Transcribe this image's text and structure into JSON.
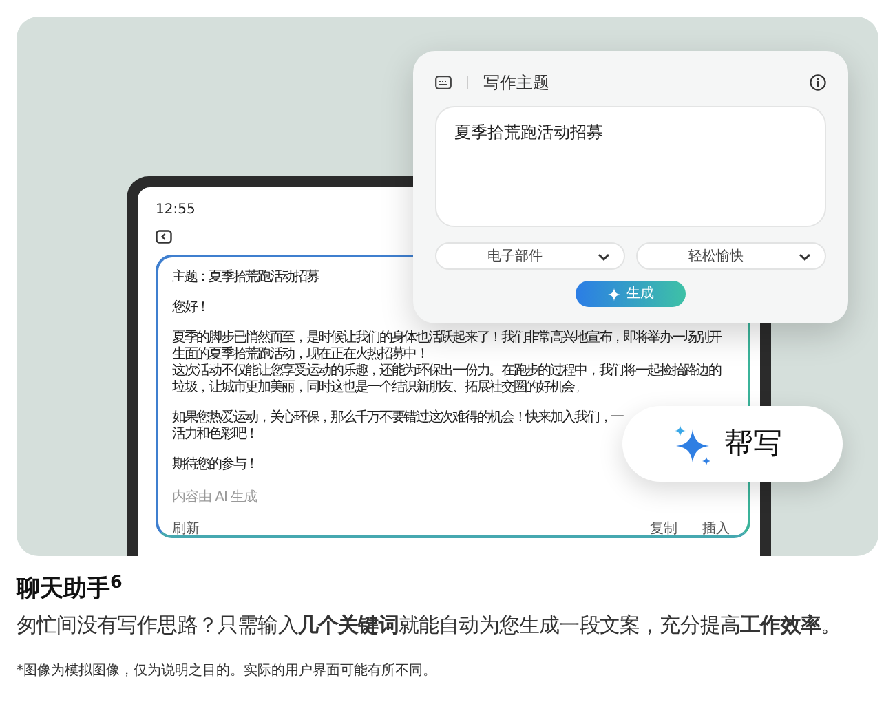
{
  "device": {
    "time": "12:55",
    "email": {
      "subject": "主题：夏季拾荒跑活动招募",
      "paragraphs": [
        {
          "lines": [
            "您好！"
          ]
        },
        {
          "lines": [
            "夏季的脚步已悄然而至，是时候让我们的身体也活跃起来了！我们非常高兴地宣布，即将举办一场别开",
            "生面的夏季拾荒跑活动，现在正在火热招募中！",
            "这次活动不仅能让您享受运动的乐趣，还能为环保出一份力。在跑步的过程中，我们将一起捡拾路边的",
            "垃圾，让城市更加美丽，同时这也是一个结识新朋友、拓展社交圈的好机会。"
          ]
        },
        {
          "lines": [
            "如果您热爱运动，关心环保，那么千万不要错过这次难得的机会！快来加入我们，一",
            "活力和色彩吧！"
          ]
        },
        {
          "lines": [
            "期待您的参与！"
          ]
        }
      ],
      "ai_note": "内容由 AI 生成",
      "left_actions": [
        "刷新"
      ],
      "right_actions": [
        "复制",
        "插入"
      ]
    }
  },
  "popup": {
    "title": "写作主题",
    "input_value": "夏季拾荒跑活动招募",
    "dropdowns": [
      {
        "label": "电子部件"
      },
      {
        "label": "轻松愉快"
      }
    ],
    "generate_button": "生成"
  },
  "help_write_button": "帮写",
  "feature": {
    "title": "聊天助手$^{6}$",
    "description": "匆忙间没有写作思路？只需输入**几个关键词**就能自动为您生成一段文案，充分提高**工作效率**。",
    "footnote": "*图像为模拟图像，仅为说明之目的。实际的用户界面可能有所不同。"
  }
}
